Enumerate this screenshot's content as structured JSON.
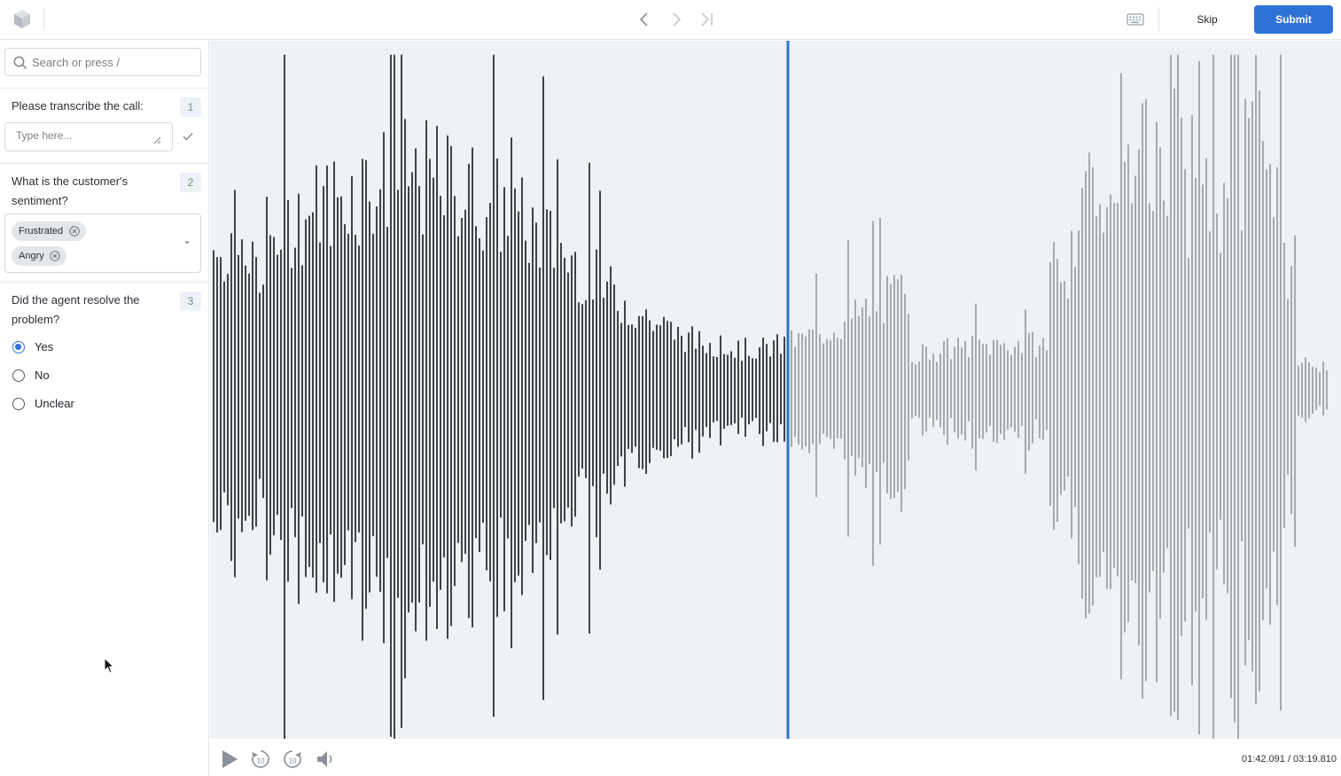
{
  "topbar": {
    "skip_label": "Skip",
    "submit_label": "Submit",
    "accent_color": "#2f72d6"
  },
  "sidebar": {
    "search": {
      "placeholder": "Search or press /",
      "value": ""
    },
    "questions": [
      {
        "number": "1",
        "text": "Please transcribe the call:",
        "input": {
          "placeholder": "Type here...",
          "value": ""
        }
      },
      {
        "number": "2",
        "text": "What is the customer's sentiment?",
        "selected_tags": [
          "Frustrated",
          "Angry"
        ]
      },
      {
        "number": "3",
        "text": "Did the agent resolve the problem?",
        "options": [
          {
            "label": "Yes",
            "checked": true
          },
          {
            "label": "No",
            "checked": false
          },
          {
            "label": "Unclear",
            "checked": false
          }
        ]
      }
    ]
  },
  "player": {
    "current_time": "01:42.091",
    "duration": "03:19.810",
    "time_display": "01:42.091 / 03:19.810",
    "progress_fraction": 0.511,
    "played_color": "#3f4247",
    "unplayed_color": "#a7a9ad",
    "playhead_color": "#2f72d6"
  },
  "icons": [
    "logo-icon",
    "chevron-left-icon",
    "chevron-right-icon",
    "skip-to-end-icon",
    "keyboard-icon",
    "search-icon",
    "check-icon",
    "chevron-down-icon",
    "close-circle-icon",
    "play-icon",
    "rewind-10-icon",
    "forward-10-icon",
    "volume-icon"
  ]
}
